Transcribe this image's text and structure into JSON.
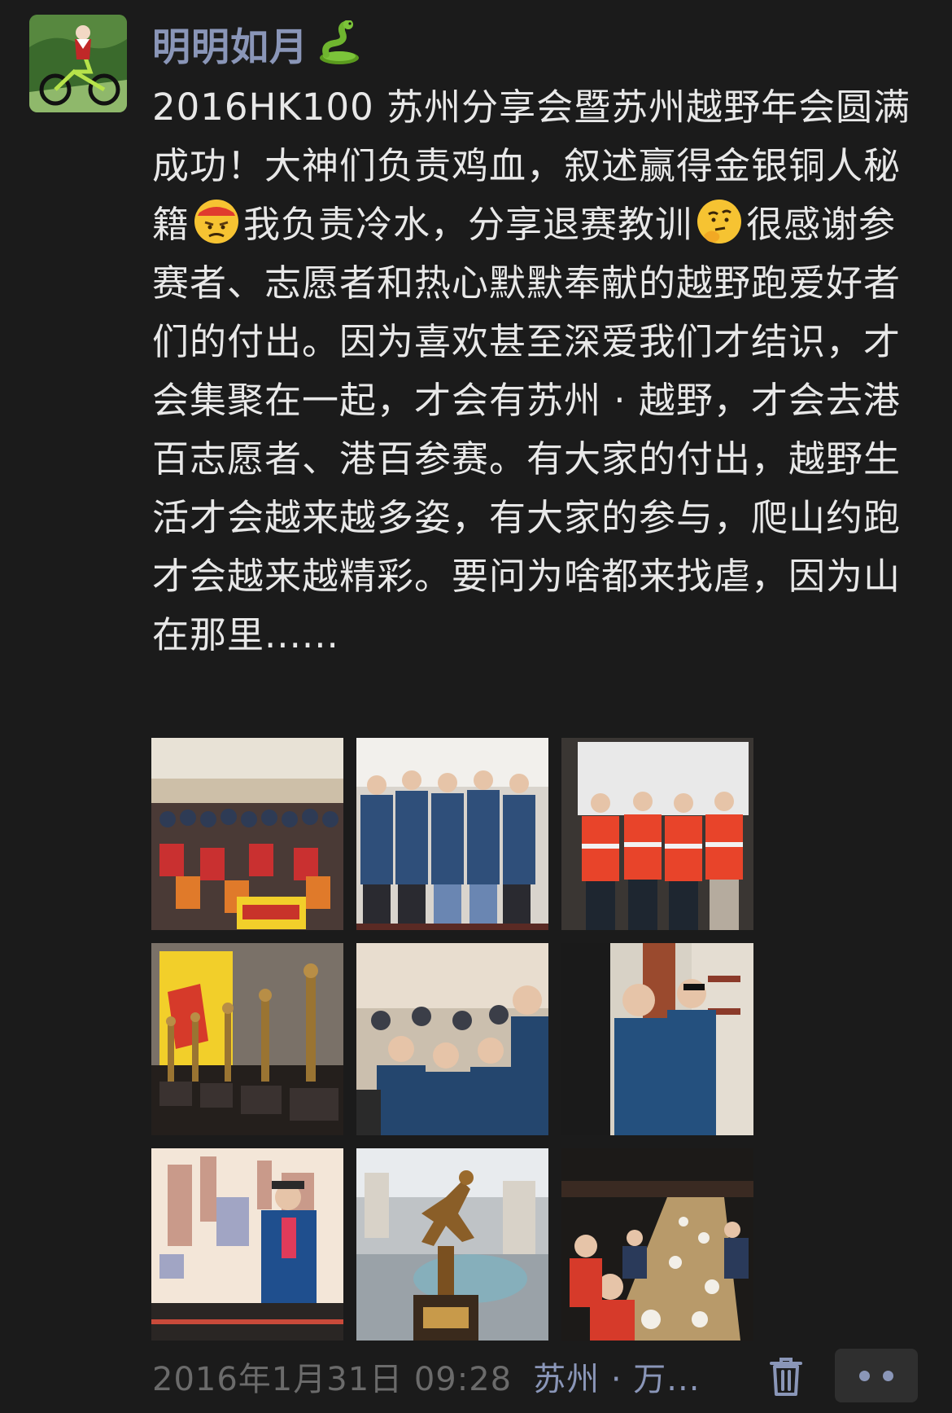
{
  "post": {
    "author": "明明如月",
    "author_icon": "snake-emoji",
    "text_parts": [
      "2016HK100 苏州分享会暨苏州越野年会圆满成功！大神们负责鸡血，叙述赢得金银铜人秘籍",
      "我负责冷水，分享退赛教训",
      "很感谢参赛者、志愿者和热心默默奉献的越野跑爱好者们的付出。因为喜欢甚至深爱我们才结识，才会集聚在一起，才会有苏州 · 越野，才会去港百志愿者、港百参赛。有大家的付出，越野生活才会越来越多姿，有大家的参与，爬山约跑才会越来越精彩。要问为啥都来找虐，因为山在那里......"
    ],
    "emojis": [
      "angry-emoji",
      "thinking-emoji"
    ],
    "photos": [
      "group-photo-with-banner",
      "men-in-blue-jackets-holding-trophies",
      "men-in-orange-vests",
      "trophies-on-table",
      "audience-in-blue-jackets",
      "two-men-drinking",
      "man-in-front-of-slide",
      "runner-trophy-closeup",
      "dinner-table-gathering"
    ],
    "timestamp": "2016年1月31日 09:28",
    "location": "苏州 · 万...",
    "delete_icon": "trash-icon",
    "more_icon": "more-dots-icon"
  },
  "colors": {
    "background": "#1b1b1b",
    "name_link": "#8a96b8",
    "text": "#e8e8e8",
    "timestamp": "#6b6b6b"
  }
}
